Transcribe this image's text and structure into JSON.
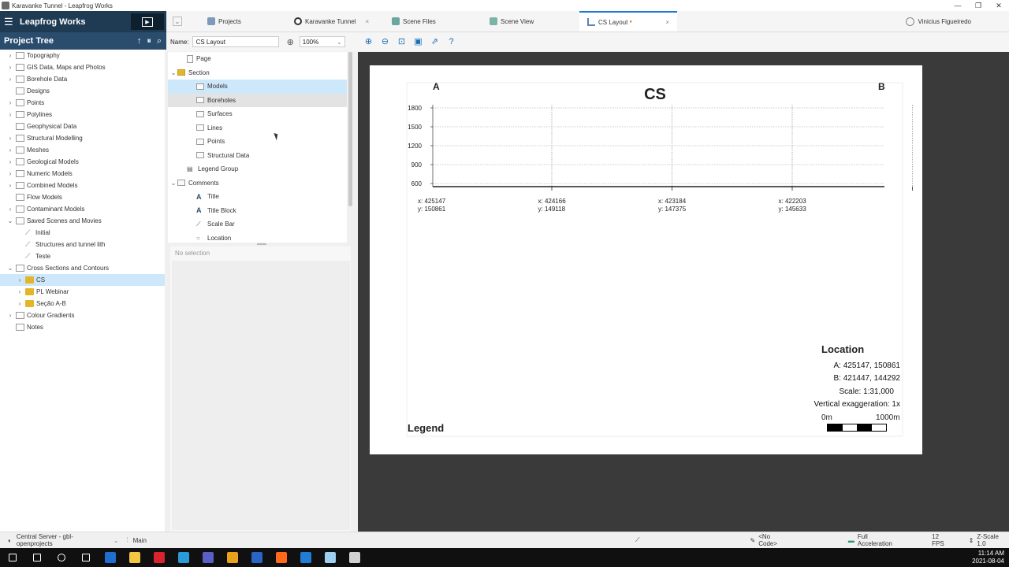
{
  "window": {
    "title": "Karavanke Tunnel - Leapfrog Works",
    "controls": [
      "—",
      "❐",
      "✕"
    ]
  },
  "brand": {
    "name": "Leapfrog Works"
  },
  "tabs": [
    {
      "label": "Projects",
      "color": "#7d9ab8",
      "active": false
    },
    {
      "label": "Karavanke Tunnel",
      "color": "#333333",
      "active": false
    },
    {
      "label": "Scene Files",
      "color": "#6aa6a0",
      "active": false
    },
    {
      "label": "Scene View",
      "color": "#7bb3a6",
      "active": false
    },
    {
      "label": "CS Layout",
      "color": "#5a86b0",
      "active": true,
      "modified": "●"
    }
  ],
  "user": {
    "name": "Vinicius Figueiredo"
  },
  "project_tree": {
    "title": "Project Tree",
    "items": [
      {
        "label": "Topography",
        "indent": 0,
        "kind": "folder",
        "twisty": "›"
      },
      {
        "label": "GIS Data, Maps and Photos",
        "indent": 0,
        "kind": "folder",
        "twisty": "›"
      },
      {
        "label": "Borehole Data",
        "indent": 0,
        "kind": "folder",
        "twisty": "›"
      },
      {
        "label": "Designs",
        "indent": 0,
        "kind": "folder",
        "twisty": ""
      },
      {
        "label": "Points",
        "indent": 0,
        "kind": "folder",
        "twisty": "›"
      },
      {
        "label": "Polylines",
        "indent": 0,
        "kind": "folder",
        "twisty": "›"
      },
      {
        "label": "Geophysical Data",
        "indent": 0,
        "kind": "folder",
        "twisty": ""
      },
      {
        "label": "Structural Modelling",
        "indent": 0,
        "kind": "folder",
        "twisty": "›"
      },
      {
        "label": "Meshes",
        "indent": 0,
        "kind": "folder",
        "twisty": "›"
      },
      {
        "label": "Geological Models",
        "indent": 0,
        "kind": "folder",
        "twisty": "›"
      },
      {
        "label": "Numeric Models",
        "indent": 0,
        "kind": "folder",
        "twisty": "›"
      },
      {
        "label": "Combined Models",
        "indent": 0,
        "kind": "folder",
        "twisty": "›"
      },
      {
        "label": "Flow Models",
        "indent": 0,
        "kind": "folder",
        "twisty": ""
      },
      {
        "label": "Contaminant Models",
        "indent": 0,
        "kind": "folder",
        "twisty": "›"
      },
      {
        "label": "Saved Scenes and Movies",
        "indent": 0,
        "kind": "folder",
        "twisty": "⌄"
      },
      {
        "label": "Initial",
        "indent": 1,
        "kind": "scene",
        "twisty": ""
      },
      {
        "label": "Structures and tunnel lith",
        "indent": 1,
        "kind": "scene",
        "twisty": ""
      },
      {
        "label": "Teste",
        "indent": 1,
        "kind": "scene",
        "twisty": ""
      },
      {
        "label": "Cross Sections and Contours",
        "indent": 0,
        "kind": "folder",
        "twisty": "⌄"
      },
      {
        "label": "CS",
        "indent": 1,
        "kind": "section",
        "twisty": "›",
        "selected": true
      },
      {
        "label": "PL Webinar",
        "indent": 1,
        "kind": "section",
        "twisty": "›"
      },
      {
        "label": "Seção A-B",
        "indent": 1,
        "kind": "section",
        "twisty": "›"
      },
      {
        "label": "Colour Gradients",
        "indent": 0,
        "kind": "folder",
        "twisty": "›"
      },
      {
        "label": "Notes",
        "indent": 0,
        "kind": "note",
        "twisty": ""
      }
    ]
  },
  "layout_editor": {
    "name_label": "Name:",
    "name_value": "CS Layout",
    "zoom_value": "100%",
    "items": [
      {
        "label": "Page",
        "indent": 1,
        "twisty": "",
        "icon": "page"
      },
      {
        "label": "Section",
        "indent": 0,
        "twisty": "⌄",
        "icon": "section"
      },
      {
        "label": "Models",
        "indent": 2,
        "twisty": "",
        "icon": "folder",
        "state": "sel1"
      },
      {
        "label": "Boreholes",
        "indent": 2,
        "twisty": "",
        "icon": "folder",
        "state": "sel2"
      },
      {
        "label": "Surfaces",
        "indent": 2,
        "twisty": "",
        "icon": "folder"
      },
      {
        "label": "Lines",
        "indent": 2,
        "twisty": "",
        "icon": "folder"
      },
      {
        "label": "Points",
        "indent": 2,
        "twisty": "",
        "icon": "folder"
      },
      {
        "label": "Structural Data",
        "indent": 2,
        "twisty": "",
        "icon": "folder"
      },
      {
        "label": "Legend Group",
        "indent": 1,
        "twisty": "",
        "icon": "legend"
      },
      {
        "label": "Comments",
        "indent": 0,
        "twisty": "⌄",
        "icon": "folder"
      },
      {
        "label": "Title",
        "indent": 2,
        "twisty": "",
        "icon": "text"
      },
      {
        "label": "Title Block",
        "indent": 2,
        "twisty": "",
        "icon": "text"
      },
      {
        "label": "Scale Bar",
        "indent": 2,
        "twisty": "",
        "icon": "scalebar"
      },
      {
        "label": "Location",
        "indent": 2,
        "twisty": "",
        "icon": "location"
      }
    ],
    "no_selection": "No selection"
  },
  "sheet": {
    "point_a": "A",
    "point_b": "B",
    "title": "CS",
    "location_title": "Location",
    "location_a": "A:   425147, 150861",
    "location_b": "B:   421447, 144292",
    "scale": "Scale: 1:31,000",
    "vexag": "Vertical exaggeration: 1x",
    "legend_title": "Legend",
    "scalebar_start": "0m",
    "scalebar_end": "1000m"
  },
  "chart_data": {
    "type": "line",
    "title": "CS",
    "yticks": [
      600,
      900,
      1200,
      1500,
      1800
    ],
    "ylim": [
      550,
      1850
    ],
    "coord_labels": [
      {
        "x": "x: 425147",
        "y": "y: 150861"
      },
      {
        "x": "x: 424166",
        "y": "y: 149118"
      },
      {
        "x": "x: 423184",
        "y": "y: 147375"
      },
      {
        "x": "x: 422203",
        "y": "y: 145633"
      }
    ],
    "grid": true
  },
  "statusbar": {
    "server": "Central Server - gbl-openprojects",
    "branch": "Main",
    "code": "<No Code>",
    "acceleration": "Full Acceleration",
    "fps": "12 FPS",
    "zscale": "Z-Scale 1.0"
  },
  "taskbar": {
    "time": "11:14 AM",
    "date": "2021-08-04",
    "apps": [
      {
        "name": "start-icon",
        "color": "#ffffff"
      },
      {
        "name": "search-icon",
        "color": "#ffffff"
      },
      {
        "name": "cortana-icon",
        "color": "#ffffff"
      },
      {
        "name": "task-view-icon",
        "color": "#ffffff"
      },
      {
        "name": "outlook-icon",
        "color": "#1e6fd0"
      },
      {
        "name": "file-explorer-icon",
        "color": "#f4c542"
      },
      {
        "name": "acrobat-icon",
        "color": "#d9232d"
      },
      {
        "name": "edge-icon",
        "color": "#2a9ad8"
      },
      {
        "name": "teams-icon",
        "color": "#5a5fc7"
      },
      {
        "name": "chrome-icon",
        "color": "#e8a21b"
      },
      {
        "name": "word-icon",
        "color": "#2b64c5"
      },
      {
        "name": "firefox-icon",
        "color": "#ff6a1a"
      },
      {
        "name": "media-player-icon",
        "color": "#1f7dd4"
      },
      {
        "name": "snowflake-icon",
        "color": "#9ed0f0"
      },
      {
        "name": "leapfrog-icon",
        "color": "#d0d0d0"
      }
    ]
  }
}
